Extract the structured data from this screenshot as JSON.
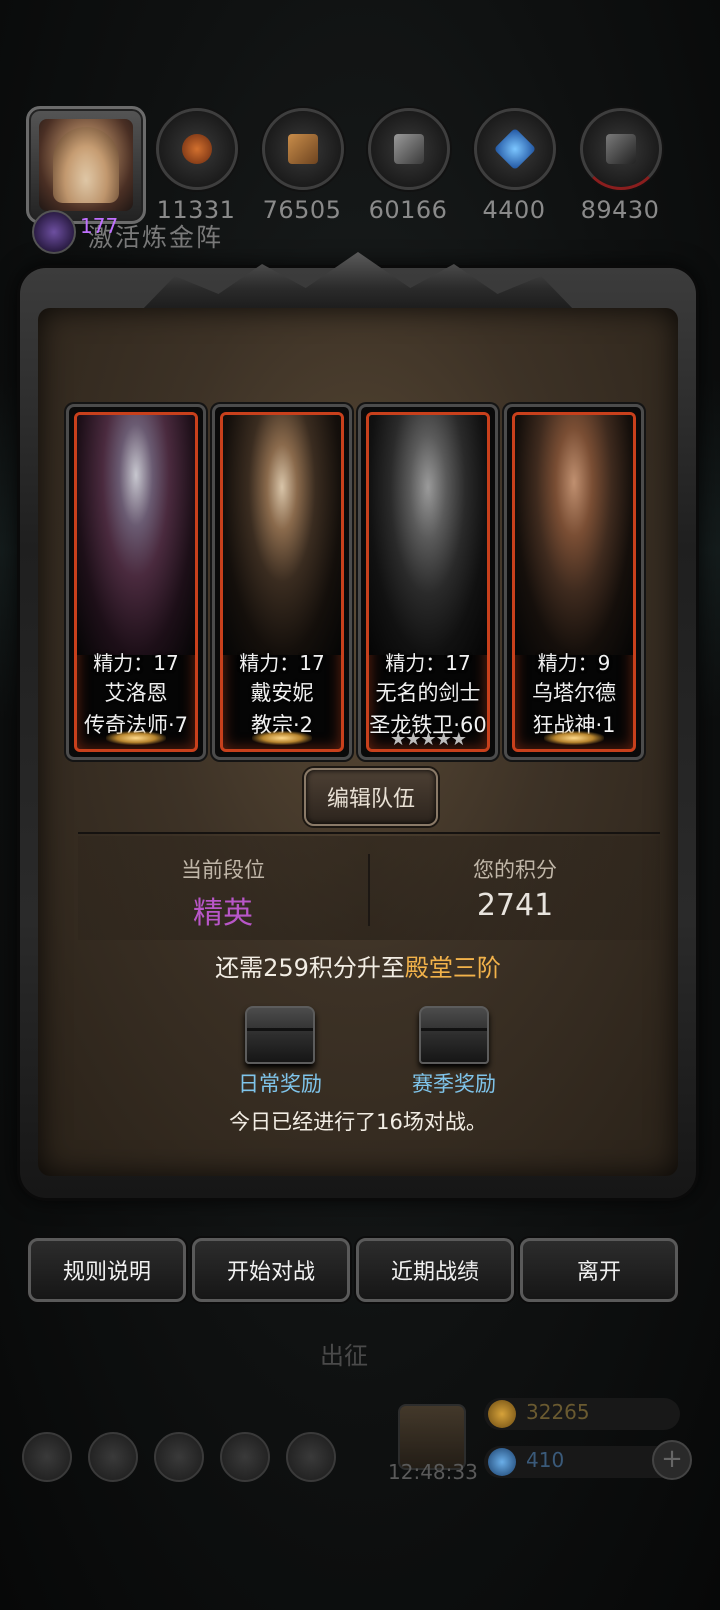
{
  "resources": [
    {
      "icon": "meat-icon",
      "value": "11331",
      "color": "#a14a20"
    },
    {
      "icon": "wood-icon",
      "value": "76505",
      "color": "#9a6a34"
    },
    {
      "icon": "stone-icon",
      "value": "60166",
      "color": "#5a5a5a"
    },
    {
      "icon": "crystal-icon",
      "value": "4400",
      "color": "#3a82c8"
    },
    {
      "icon": "iron-icon",
      "value": "89430",
      "color": "#4a4a4a"
    }
  ],
  "player": {
    "level": "177",
    "background_title": "激活炼金阵"
  },
  "heroes": [
    {
      "stamina": "精力：17",
      "name": "艾洛恩",
      "class": "传奇法师·7",
      "stars": ""
    },
    {
      "stamina": "精力：17",
      "name": "戴安妮",
      "class": "教宗·2",
      "stars": ""
    },
    {
      "stamina": "精力：17",
      "name": "无名的剑士",
      "class": "圣龙铁卫·60",
      "stars": "★★★★★"
    },
    {
      "stamina": "精力：9",
      "name": "乌塔尔德",
      "class": "狂战神·1",
      "stars": ""
    }
  ],
  "edit_team": "编辑队伍",
  "rank": {
    "label": "当前段位",
    "value": "精英",
    "color": "#b856c8"
  },
  "score": {
    "label": "您的积分",
    "value": "2741"
  },
  "promotion": {
    "prefix": "还需259积分升至",
    "target": "殿堂三阶"
  },
  "rewards": {
    "daily": "日常奖励",
    "season": "赛季奖励"
  },
  "battles_today": "今日已经进行了16场对战。",
  "buttons": {
    "rules": "规则说明",
    "start": "开始对战",
    "history": "近期战绩",
    "leave": "离开"
  },
  "background": {
    "expedition": "出征",
    "timer": "12:48:33",
    "gold": "32265",
    "gems": "410"
  }
}
